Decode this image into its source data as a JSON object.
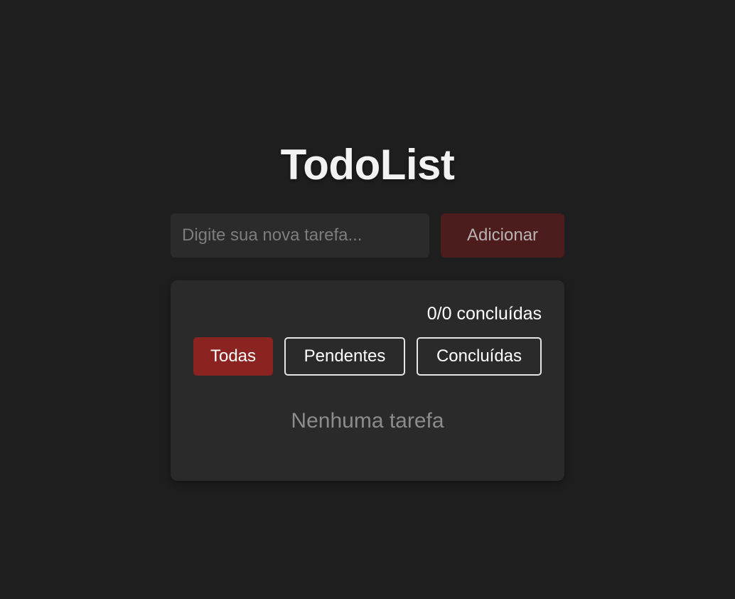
{
  "app": {
    "title": "TodoList"
  },
  "new_task": {
    "value": "",
    "placeholder": "Digite sua nova tarefa...",
    "add_label": "Adicionar"
  },
  "summary": {
    "counter": "0/0 concluídas",
    "completed": 0,
    "total": 0
  },
  "filters": [
    {
      "label": "Todas",
      "active": true
    },
    {
      "label": "Pendentes",
      "active": false
    },
    {
      "label": "Concluídas",
      "active": false
    }
  ],
  "task_list": {
    "items": [],
    "empty_message": "Nenhuma tarefa"
  },
  "colors": {
    "background": "#1e1e1e",
    "card": "#2a2a2a",
    "accent": "#8b2320",
    "add_button": "#4d1d1d"
  }
}
